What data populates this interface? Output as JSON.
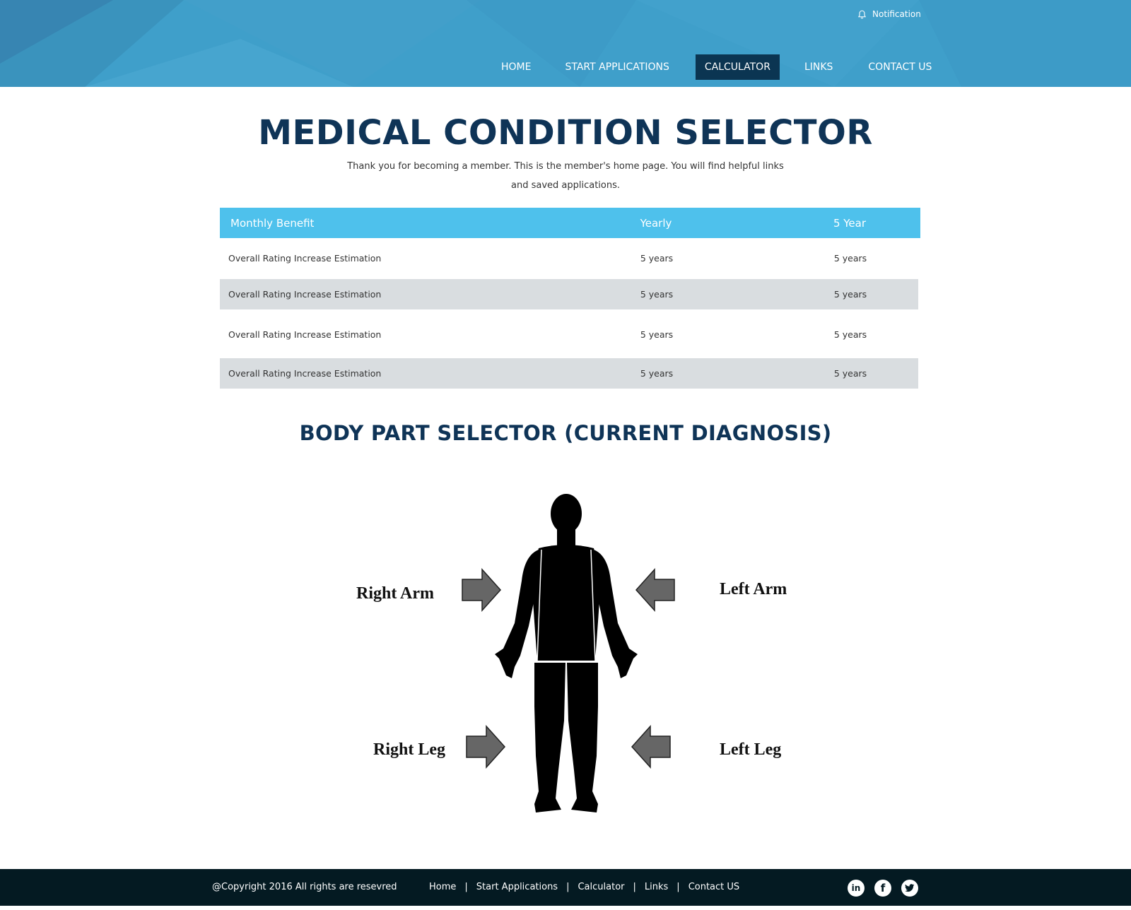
{
  "header": {
    "notification_label": "Notification",
    "notification_icon": "bell-icon",
    "nav": [
      {
        "label": "HOME",
        "active": false
      },
      {
        "label": "START APPLICATIONS",
        "active": false
      },
      {
        "label": "CALCULATOR",
        "active": true
      },
      {
        "label": "LINKS",
        "active": false
      },
      {
        "label": "CONTACT US",
        "active": false
      }
    ]
  },
  "main": {
    "title": "MEDICAL CONDITION SELECTOR",
    "intro": "Thank you for becoming a member. This is the member's home page. You will find helpful links and saved applications.",
    "table": {
      "headers": [
        "Monthly Benefit",
        "Yearly",
        "5 Year"
      ],
      "rows": [
        [
          "Overall Rating Increase Estimation",
          "5 years",
          "5 years"
        ],
        [
          "Overall Rating Increase Estimation",
          "5 years",
          "5 years"
        ],
        [
          "Overall Rating Increase Estimation",
          "5 years",
          "5 years"
        ],
        [
          "Overall Rating Increase Estimation",
          "5 years",
          "5 years"
        ]
      ]
    },
    "body_selector": {
      "title": "BODY PART SELECTOR (CURRENT DIAGNOSIS)",
      "parts": {
        "right_arm": "Right Arm",
        "left_arm": "Left Arm",
        "right_leg": "Right Leg",
        "left_leg": "Left Leg"
      }
    }
  },
  "footer": {
    "copyright": "@Copyright 2016 All rights are resevred",
    "links": [
      "Home",
      "Start Applications",
      "Calculator",
      "Links",
      "Contact US"
    ],
    "separator": "|",
    "social": [
      {
        "icon": "linkedin-icon",
        "glyph": "in"
      },
      {
        "icon": "facebook-icon",
        "glyph": "f"
      },
      {
        "icon": "twitter-icon",
        "glyph": "t"
      }
    ]
  },
  "colors": {
    "header_bg": "#3f9fca",
    "nav_active": "#0b3552",
    "title": "#0f3457",
    "table_header": "#4ec1ec",
    "row_alt": "#d9dde0",
    "footer_bg": "#041a22"
  }
}
